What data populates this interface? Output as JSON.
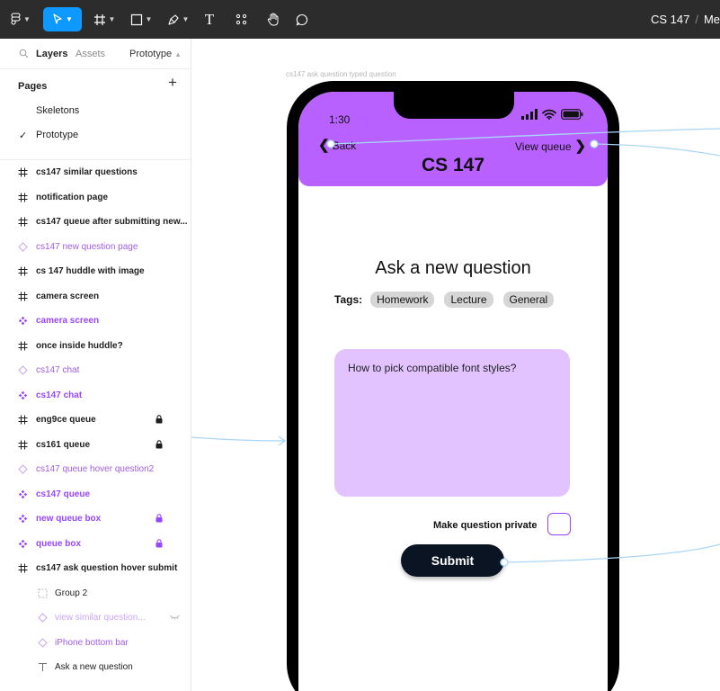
{
  "toolbar": {
    "tools": [
      {
        "name": "main-menu",
        "icon": "figma-logo-icon"
      },
      {
        "name": "move-tool",
        "icon": "cursor-icon",
        "active": true
      },
      {
        "name": "frame-tool",
        "icon": "hash-icon"
      },
      {
        "name": "shape-tool",
        "icon": "rectangle-icon"
      },
      {
        "name": "pen-tool",
        "icon": "pen-icon"
      },
      {
        "name": "text-tool",
        "icon": "text-icon"
      },
      {
        "name": "resources",
        "icon": "components-icon"
      },
      {
        "name": "hand-tool",
        "icon": "hand-icon"
      },
      {
        "name": "comment-tool",
        "icon": "comment-icon"
      }
    ],
    "text_tool_glyph": "T",
    "file_name": "CS 147",
    "separator": "/",
    "page_name": "Me"
  },
  "panel": {
    "tabs": {
      "layers": "Layers",
      "assets": "Assets",
      "prototype": "Prototype"
    },
    "pages_heading": "Pages",
    "add_page": "+",
    "pages": [
      {
        "label": "Skeletons",
        "current": false
      },
      {
        "label": "Prototype",
        "current": true
      }
    ],
    "layers": [
      {
        "label": "cs147 similar questions",
        "kind": "frame"
      },
      {
        "label": "notification page",
        "kind": "frame"
      },
      {
        "label": "cs147 queue after submitting new...",
        "kind": "frame"
      },
      {
        "label": "cs147 new question page",
        "kind": "instance"
      },
      {
        "label": "cs 147 huddle with image",
        "kind": "frame"
      },
      {
        "label": "camera screen",
        "kind": "frame"
      },
      {
        "label": "camera screen",
        "kind": "component"
      },
      {
        "label": "once inside huddle?",
        "kind": "frame"
      },
      {
        "label": "cs147 chat",
        "kind": "instance"
      },
      {
        "label": "cs147 chat",
        "kind": "component"
      },
      {
        "label": "eng9ce queue",
        "kind": "frame",
        "locked": true
      },
      {
        "label": "cs161 queue",
        "kind": "frame",
        "locked": true
      },
      {
        "label": "cs147 queue hover question2",
        "kind": "instance"
      },
      {
        "label": "cs147 queue",
        "kind": "component"
      },
      {
        "label": "new queue box",
        "kind": "component",
        "locked": true
      },
      {
        "label": "queue box",
        "kind": "component",
        "locked": true
      },
      {
        "label": "cs147 ask question hover submit",
        "kind": "frame"
      },
      {
        "label": "Group 2",
        "kind": "group"
      },
      {
        "label": "view similar question...",
        "kind": "instance",
        "hidden": true
      },
      {
        "label": "iPhone bottom bar",
        "kind": "instance"
      },
      {
        "label": "Ask a new question",
        "kind": "text"
      }
    ]
  },
  "canvas": {
    "frame_label": "cs147 ask question typed question",
    "phone": {
      "time": "1:30",
      "back_label": "Back",
      "view_queue_label": "View queue",
      "course_title": "CS 147",
      "heading": "Ask a new question",
      "tags_label": "Tags:",
      "tags": [
        "Homework",
        "Lecture",
        "General"
      ],
      "question_text": "How to pick compatible font styles?",
      "private_label": "Make question private",
      "private_checked": false,
      "submit_label": "Submit"
    }
  },
  "colors": {
    "toolbar_bg": "#2c2c2c",
    "accent_blue": "#0d99ff",
    "header_purple": "#b961ff",
    "question_box": "#e2c3ff",
    "component_purple": "#9747ff",
    "submit_bg": "#0b1422",
    "connector": "#a9d6f5"
  }
}
